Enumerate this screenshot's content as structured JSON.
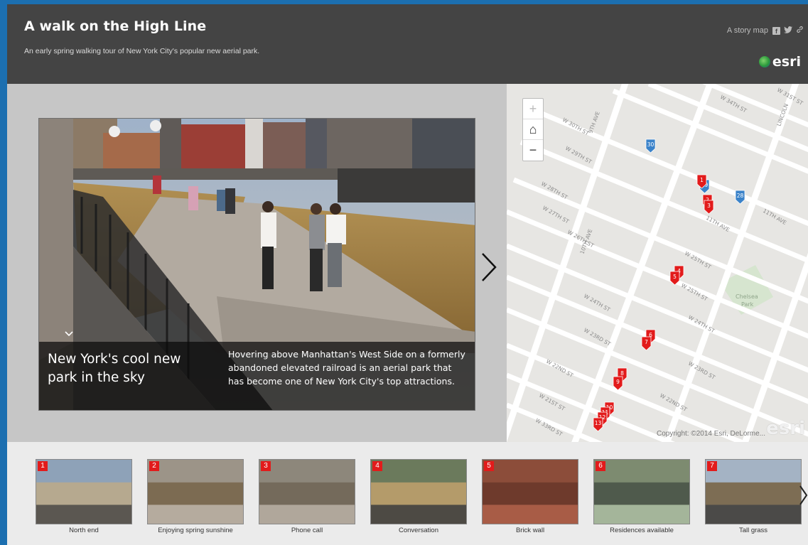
{
  "header": {
    "title": "A walk on the High Line",
    "subtitle": "An early spring walking tour of New York City's popular new aerial park.",
    "story_map_label": "A story map",
    "esri_logo": "esri",
    "share_icons": [
      "facebook-icon",
      "twitter-icon",
      "link-icon"
    ]
  },
  "media": {
    "caption_title": "New York's cool new park in the sky",
    "caption_text": "Hovering above Manhattan's West Side on a formerly abandoned elevated railroad is an aerial park that has become one of New York City's top attractions."
  },
  "map": {
    "zoom_in": "+",
    "home": "⌂",
    "zoom_out": "−",
    "copyright": "Copyright: ©2014 Esri, DeLorme...",
    "watermark": "esri",
    "park_label_1": "Chelsea",
    "park_label_2": "Park",
    "streets": [
      {
        "label": "W 30TH ST"
      },
      {
        "label": "W 29TH ST"
      },
      {
        "label": "W 28TH ST"
      },
      {
        "label": "W 27TH ST"
      },
      {
        "label": "W 26TH ST"
      },
      {
        "label": "W 25TH ST"
      },
      {
        "label": "W 24TH ST"
      },
      {
        "label": "W 23RD ST"
      },
      {
        "label": "W 22ND ST"
      },
      {
        "label": "W 21ST ST"
      },
      {
        "label": "W 33RD ST"
      },
      {
        "label": "W 34TH ST"
      },
      {
        "label": "W 31ST ST"
      },
      {
        "label": "11TH AVE"
      },
      {
        "label": "10TH AVE"
      },
      {
        "label": "9TH AVE"
      },
      {
        "label": "LINCOLN"
      }
    ],
    "markers": [
      {
        "num": "30",
        "color": "#3a82c9"
      },
      {
        "num": "29",
        "color": "#3a82c9"
      },
      {
        "num": "28",
        "color": "#3a82c9"
      },
      {
        "num": "1",
        "color": "#e21b1b"
      },
      {
        "num": "2",
        "color": "#e21b1b"
      },
      {
        "num": "3",
        "color": "#e21b1b"
      },
      {
        "num": "4",
        "color": "#e21b1b"
      },
      {
        "num": "5",
        "color": "#e21b1b"
      },
      {
        "num": "6",
        "color": "#e21b1b"
      },
      {
        "num": "7",
        "color": "#e21b1b"
      },
      {
        "num": "8",
        "color": "#e21b1b"
      },
      {
        "num": "9",
        "color": "#e21b1b"
      },
      {
        "num": "10",
        "color": "#e21b1b"
      },
      {
        "num": "11",
        "color": "#e21b1b"
      },
      {
        "num": "12",
        "color": "#e21b1b"
      },
      {
        "num": "13",
        "color": "#e21b1b"
      }
    ]
  },
  "thumbnails": [
    {
      "num": "1",
      "label": "North end"
    },
    {
      "num": "2",
      "label": "Enjoying spring sunshine"
    },
    {
      "num": "3",
      "label": "Phone call"
    },
    {
      "num": "4",
      "label": "Conversation"
    },
    {
      "num": "5",
      "label": "Brick wall"
    },
    {
      "num": "6",
      "label": "Residences available"
    },
    {
      "num": "7",
      "label": "Tall grass"
    }
  ],
  "colors": {
    "frame_blue": "#1c6fb0",
    "header_bg": "#444444",
    "accent_red": "#e21b1b",
    "accent_blue": "#3a82c9"
  }
}
